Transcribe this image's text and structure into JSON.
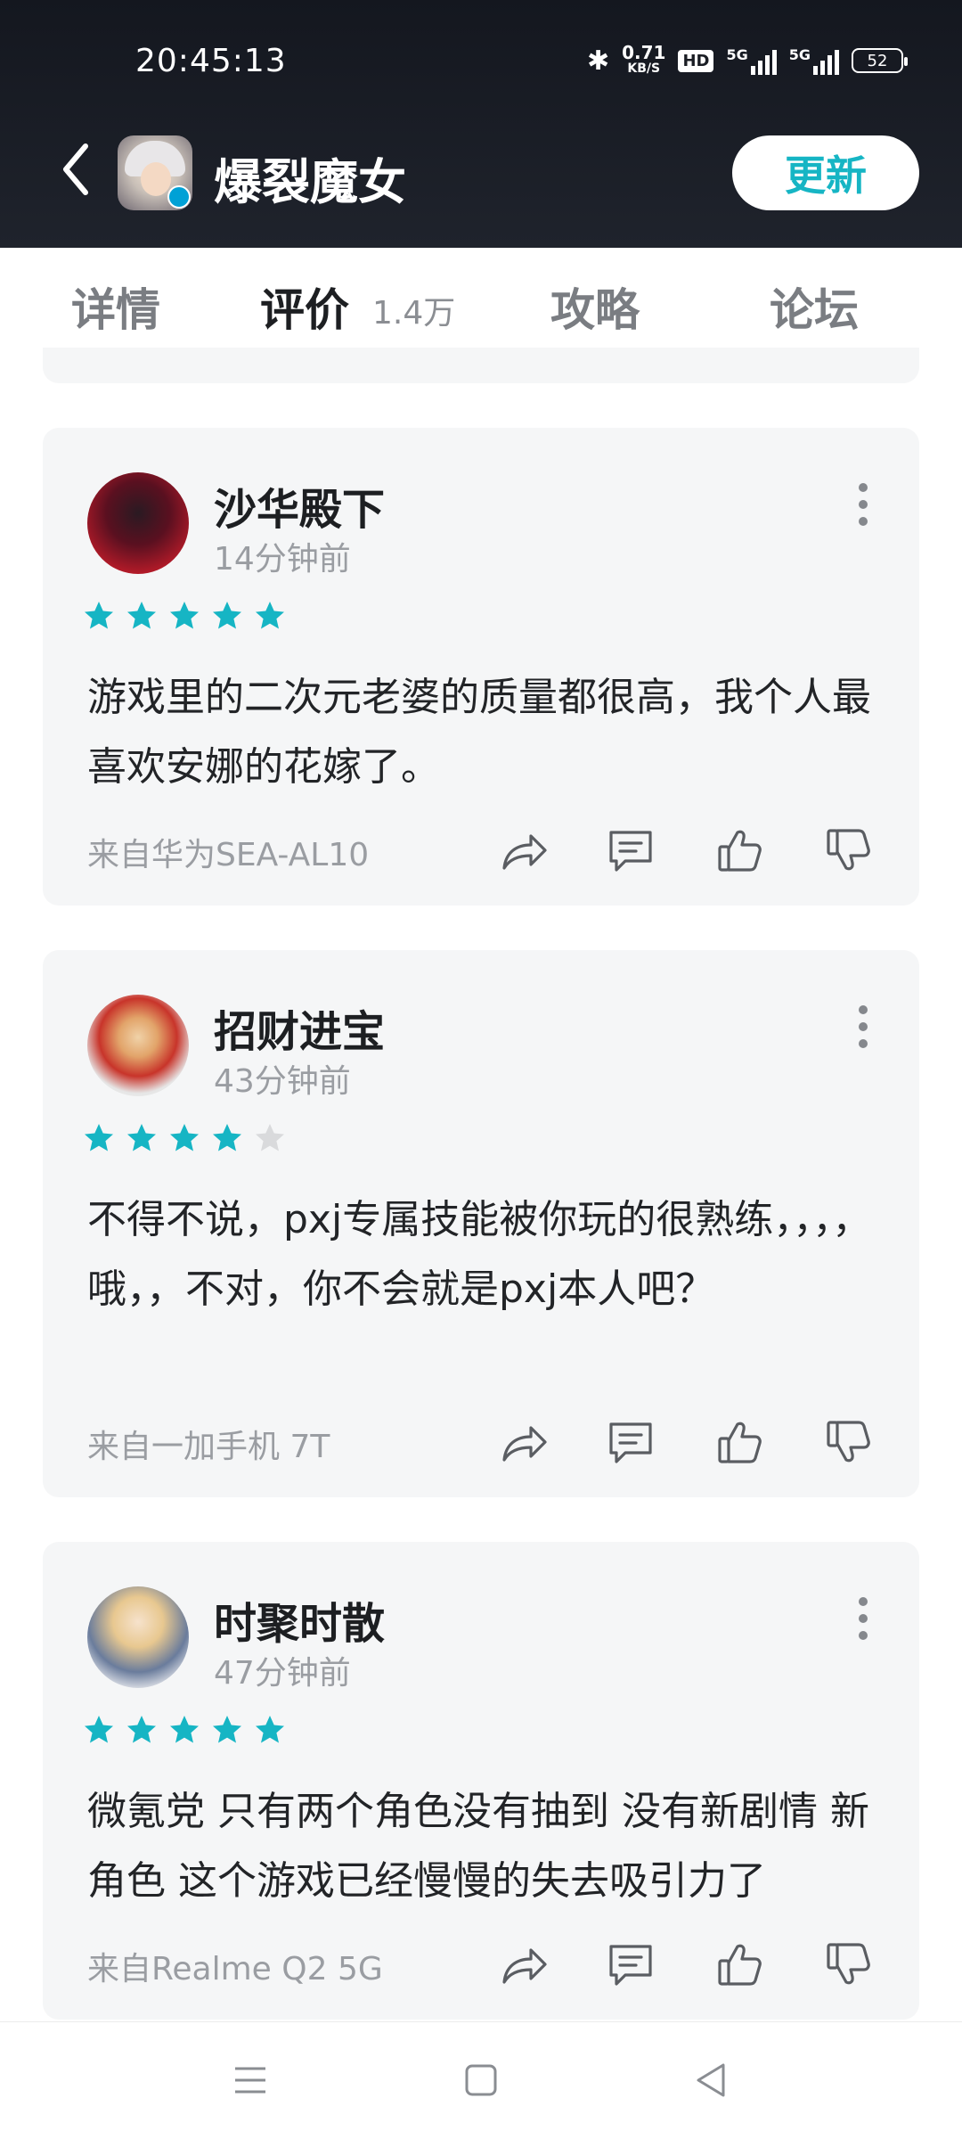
{
  "status_bar": {
    "time": "20:45:13",
    "net_speed_value": "0.71",
    "net_speed_unit": "KB/S",
    "hd_badge": "HD",
    "signal1_label": "5G",
    "signal2_label": "5G",
    "battery": "52"
  },
  "header": {
    "title": "爆裂魔女",
    "update_button": "更新"
  },
  "tabs": [
    {
      "label": "详情"
    },
    {
      "label": "评价",
      "count": "1.4万"
    },
    {
      "label": "攻略"
    },
    {
      "label": "论坛"
    }
  ],
  "colors": {
    "accent": "#16b5c4",
    "header_bg": "#1a1d24",
    "card_bg": "#f5f6f7",
    "star_on": "#16b5c4",
    "star_off": "#d9dadc"
  },
  "reviews": [
    {
      "username": "沙华殿下",
      "time": "14分钟前",
      "rating": 5,
      "text": "游戏里的二次元老婆的质量都很高，我个人最喜欢安娜的花嫁了。",
      "device": "来自华为SEA-AL10"
    },
    {
      "username": "招财进宝",
      "time": "43分钟前",
      "rating": 4,
      "text": "不得不说，pxj专属技能被你玩的很熟练，，，，哦，，不对，你不会就是pxj本人吧？",
      "device": "来自一加手机 7T"
    },
    {
      "username": "时聚时散",
      "time": "47分钟前",
      "rating": 5,
      "text": "微氪党 只有两个角色没有抽到 没有新剧情 新角色 这个游戏已经慢慢的失去吸引力了",
      "device": "来自Realme Q2 5G"
    }
  ],
  "icons": {
    "back": "chevron-left-icon",
    "share": "share-icon",
    "comment": "comment-icon",
    "like": "thumbs-up-icon",
    "dislike": "thumbs-down-icon",
    "more": "more-vertical-icon",
    "nav_menu": "menu-icon",
    "nav_home": "home-square-icon",
    "nav_back": "back-triangle-icon"
  }
}
